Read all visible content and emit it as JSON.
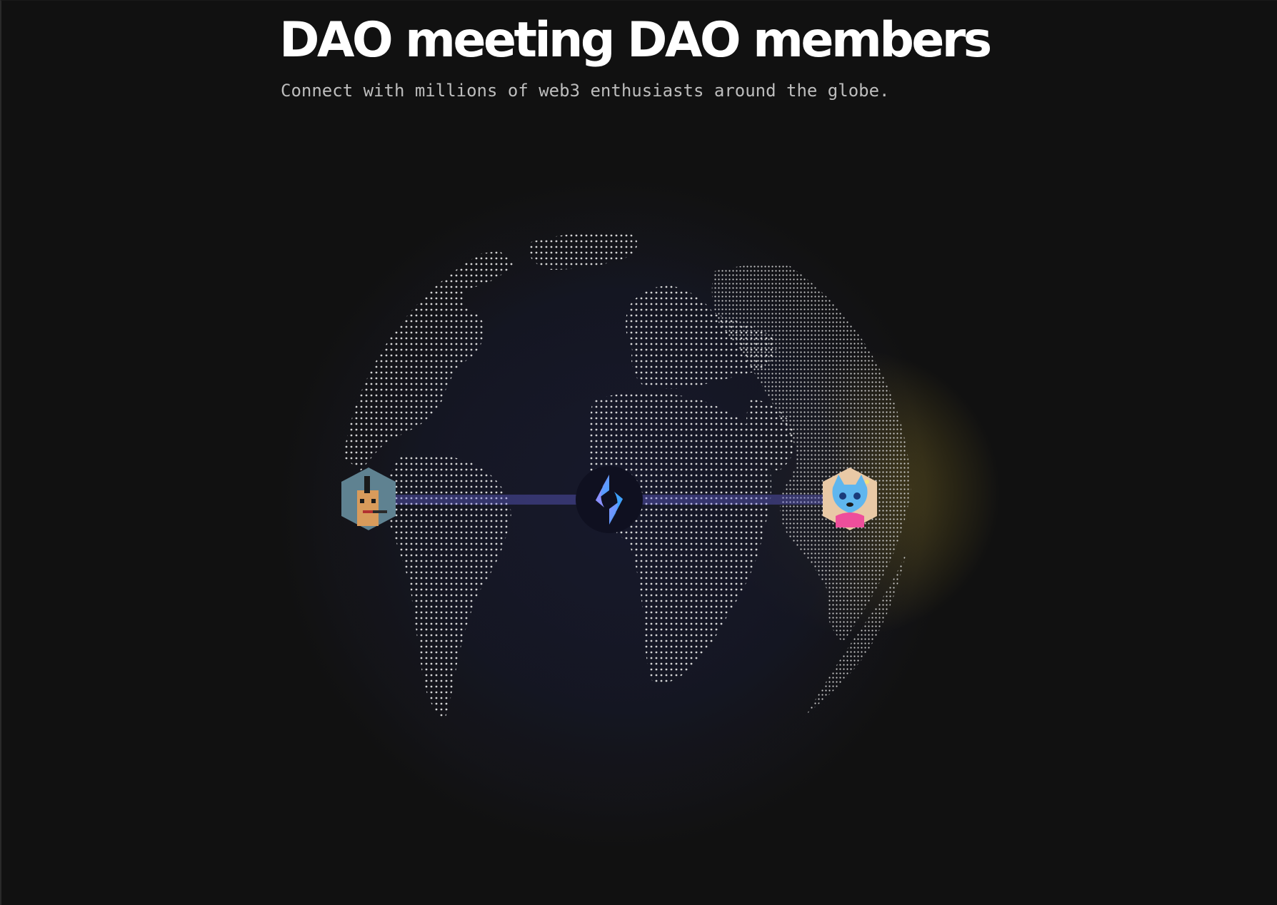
{
  "hero": {
    "title": "DAO meeting DAO members",
    "subtitle": "Connect with millions of web3 enthusiasts around the globe."
  },
  "globe": {
    "icons": {
      "left_avatar": "pixel-punk-avatar-icon",
      "center_hub": "ens-logo-icon",
      "right_avatar": "blue-cat-avatar-icon"
    },
    "colors": {
      "background": "#111111",
      "dots": "#e6e6e6",
      "connection_line": "#6f6cf2",
      "glow_warm": "#b59a2a",
      "glow_cool": "#4a4fc0",
      "ens_gradient_top": "#8a90ff",
      "ens_gradient_bottom": "#3fa2ff"
    }
  }
}
